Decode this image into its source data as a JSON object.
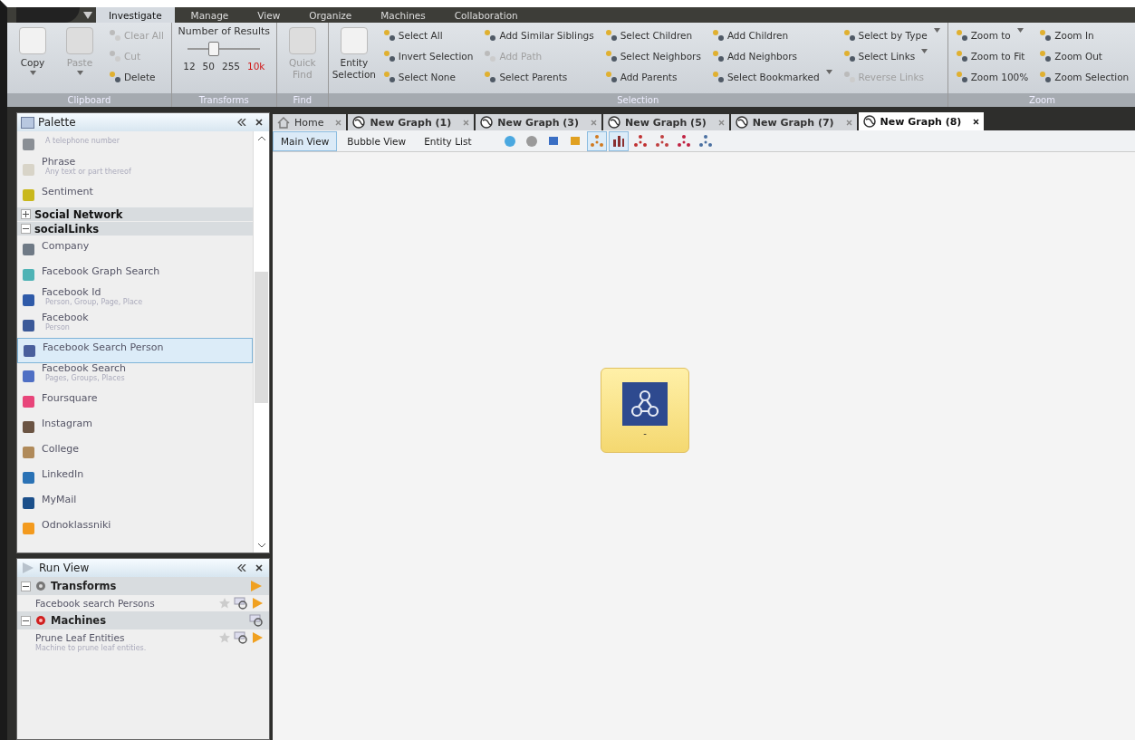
{
  "menu_tabs": [
    {
      "label": "Investigate",
      "selected": true
    },
    {
      "label": "Manage",
      "selected": false
    },
    {
      "label": "View",
      "selected": false
    },
    {
      "label": "Organize",
      "selected": false
    },
    {
      "label": "Machines",
      "selected": false
    },
    {
      "label": "Collaboration",
      "selected": false
    }
  ],
  "ribbon": [
    {
      "kind": "buttons",
      "title": "Clipboard",
      "large": [
        {
          "label": "Copy",
          "disabled": false,
          "dropdown": true
        },
        {
          "label": "Paste",
          "disabled": true,
          "dropdown": true
        }
      ],
      "columns": [
        [
          {
            "label": "Clear All",
            "disabled": true,
            "dropdown": false
          },
          {
            "label": "Cut",
            "disabled": true,
            "dropdown": false
          },
          {
            "label": "Delete",
            "disabled": false,
            "dropdown": false
          }
        ]
      ]
    },
    {
      "kind": "slider",
      "title": "Transforms",
      "label": "Number of Results",
      "level": 0.35,
      "ticks": [
        {
          "label": "12",
          "selected": false
        },
        {
          "label": "50",
          "selected": false
        },
        {
          "label": "255",
          "selected": false
        },
        {
          "label": "10k",
          "selected": true
        }
      ]
    },
    {
      "kind": "buttons",
      "title": "Find",
      "large": [
        {
          "label": "Quick Find",
          "disabled": true,
          "dropdown": false
        }
      ]
    },
    {
      "kind": "buttons",
      "title": "Selection",
      "large": [
        {
          "label": "Entity Selection",
          "disabled": false,
          "dropdown": false
        }
      ],
      "columns": [
        [
          {
            "label": "Select All",
            "disabled": false,
            "dropdown": false
          },
          {
            "label": "Invert Selection",
            "disabled": false,
            "dropdown": false
          },
          {
            "label": "Select None",
            "disabled": false,
            "dropdown": false
          }
        ],
        [
          {
            "label": "Add Similar Siblings",
            "disabled": false,
            "dropdown": false
          },
          {
            "label": "Add Path",
            "disabled": true,
            "dropdown": false
          },
          {
            "label": "Select Parents",
            "disabled": false,
            "dropdown": false
          }
        ],
        [
          {
            "label": "Select Children",
            "disabled": false,
            "dropdown": false
          },
          {
            "label": "Select Neighbors",
            "disabled": false,
            "dropdown": false
          },
          {
            "label": "Add Parents",
            "disabled": false,
            "dropdown": false
          }
        ],
        [
          {
            "label": "Add Children",
            "disabled": false,
            "dropdown": false
          },
          {
            "label": "Add Neighbors",
            "disabled": false,
            "dropdown": false
          },
          {
            "label": "Select Bookmarked",
            "disabled": false,
            "dropdown": true
          }
        ],
        [
          {
            "label": "Select by Type",
            "disabled": false,
            "dropdown": true
          },
          {
            "label": "Select Links",
            "disabled": false,
            "dropdown": true
          },
          {
            "label": "Reverse Links",
            "disabled": true,
            "dropdown": false
          }
        ]
      ]
    },
    {
      "kind": "buttons",
      "title": "Zoom",
      "columns": [
        [
          {
            "label": "Zoom to",
            "disabled": false,
            "dropdown": true
          },
          {
            "label": "Zoom to Fit",
            "disabled": false,
            "dropdown": false
          },
          {
            "label": "Zoom 100%",
            "disabled": false,
            "dropdown": false
          }
        ],
        [
          {
            "label": "Zoom In",
            "disabled": false,
            "dropdown": false
          },
          {
            "label": "Zoom Out",
            "disabled": false,
            "dropdown": false
          },
          {
            "label": "Zoom Selection",
            "disabled": false,
            "dropdown": false
          }
        ]
      ]
    }
  ],
  "palette": {
    "title": "Palette",
    "items": [
      {
        "kind": "entity",
        "description": "A telephone number",
        "color": "#8a8f95",
        "selected": false
      },
      {
        "kind": "entity",
        "name": "Phrase",
        "description": "Any text or part thereof",
        "color": "#d8d4c8",
        "selected": false
      },
      {
        "kind": "entity",
        "name": "Sentiment",
        "color": "#c9b81c",
        "selected": false
      },
      {
        "kind": "category",
        "label": "Social Network",
        "expanded": false
      },
      {
        "kind": "category",
        "label": "socialLinks",
        "expanded": true
      },
      {
        "kind": "entity",
        "name": "Company",
        "color": "#6f7a86",
        "selected": false
      },
      {
        "kind": "entity",
        "name": "Facebook Graph Search",
        "color": "#4fb3b5",
        "selected": false
      },
      {
        "kind": "entity",
        "name": "Facebook Id",
        "description": "Person, Group, Page, Place",
        "color": "#2f5aa8",
        "selected": false
      },
      {
        "kind": "entity",
        "name": "Facebook",
        "description": "Person",
        "color": "#3b5998",
        "selected": false
      },
      {
        "kind": "entity",
        "name": "Facebook Search Person",
        "color": "#4a5f9c",
        "selected": true
      },
      {
        "kind": "entity",
        "name": "Facebook Search",
        "description": "Pages, Groups, Places",
        "color": "#4f6fc4",
        "selected": false
      },
      {
        "kind": "entity",
        "name": "Foursquare",
        "color": "#e8457a",
        "selected": false
      },
      {
        "kind": "entity",
        "name": "Instagram",
        "color": "#6b5443",
        "selected": false
      },
      {
        "kind": "entity",
        "name": "College",
        "color": "#b08a5a",
        "selected": false
      },
      {
        "kind": "entity",
        "name": "LinkedIn",
        "color": "#2a72b5",
        "selected": false
      },
      {
        "kind": "entity",
        "name": "MyMail",
        "color": "#1b4f8a",
        "selected": false
      },
      {
        "kind": "entity",
        "name": "Odnoklassniki",
        "color": "#f39a1e",
        "selected": false
      }
    ]
  },
  "run_view": {
    "title": "Run View",
    "sections": [
      {
        "kind": "transforms",
        "label": "Transforms",
        "expanded": true,
        "items": [
          {
            "name": "Facebook search Persons"
          }
        ]
      },
      {
        "kind": "machines",
        "label": "Machines",
        "expanded": true,
        "items": [
          {
            "name": "Prune Leaf Entities",
            "description": "Machine to prune leaf entities."
          }
        ]
      }
    ]
  },
  "graph_tabs": [
    {
      "kind": "home",
      "label": "Home",
      "selected": false
    },
    {
      "kind": "graph",
      "label": "New Graph (1)",
      "selected": false
    },
    {
      "kind": "graph",
      "label": "New Graph (3)",
      "selected": false
    },
    {
      "kind": "graph",
      "label": "New Graph (5)",
      "selected": false
    },
    {
      "kind": "graph",
      "label": "New Graph (7)",
      "selected": false
    },
    {
      "kind": "graph",
      "label": "New Graph (8)",
      "selected": true
    }
  ],
  "view_tabs": [
    {
      "label": "Main View",
      "selected": true
    },
    {
      "label": "Bubble View",
      "selected": false
    },
    {
      "label": "Entity List",
      "selected": false
    }
  ],
  "toolbar": [
    {
      "kind": "snowflake",
      "selected": false
    },
    {
      "kind": "circle",
      "selected": false
    },
    {
      "kind": "monitor",
      "selected": false
    },
    {
      "kind": "lock",
      "selected": false
    },
    {
      "kind": "nodes",
      "selected": true
    },
    {
      "kind": "bars",
      "selected": true
    },
    {
      "kind": "tree",
      "selected": false
    },
    {
      "kind": "organic",
      "selected": false
    },
    {
      "kind": "cross",
      "selected": false
    },
    {
      "kind": "scatter",
      "selected": false
    }
  ],
  "graph": {
    "nodes": [
      {
        "label": "-"
      }
    ]
  }
}
